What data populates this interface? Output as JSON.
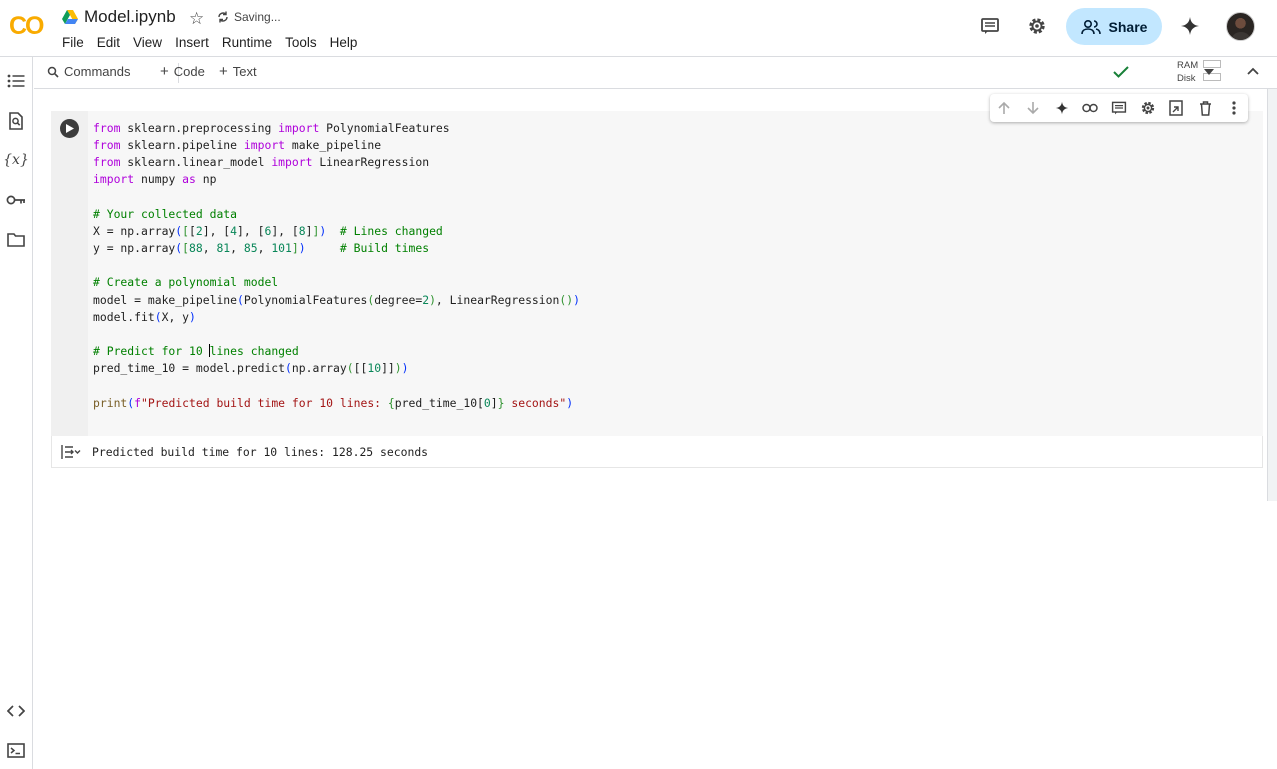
{
  "app": {
    "logo_text": "CO",
    "filename": "Model.ipynb",
    "save_status": "Saving...",
    "menu": [
      "File",
      "Edit",
      "View",
      "Insert",
      "Runtime",
      "Tools",
      "Help"
    ],
    "share_label": "Share"
  },
  "toolbar": {
    "commands_label": "Commands",
    "add_code_label": "Code",
    "add_text_label": "Text",
    "ram_label": "RAM",
    "disk_label": "Disk"
  },
  "cell": {
    "code_lines": [
      "from sklearn.preprocessing import PolynomialFeatures",
      "from sklearn.pipeline import make_pipeline",
      "from sklearn.linear_model import LinearRegression",
      "import numpy as np",
      "",
      "# Your collected data",
      "X = np.array([[2], [4], [6], [8]])  # Lines changed",
      "y = np.array([88, 81, 85, 101])     # Build times",
      "",
      "# Create a polynomial model",
      "model = make_pipeline(PolynomialFeatures(degree=2), LinearRegression())",
      "model.fit(X, y)",
      "",
      "# Predict for 10 lines changed",
      "pred_time_10 = model.predict(np.array([[10]]))",
      "",
      "print(f\"Predicted build time for 10 lines: {pred_time_10[0]} seconds\")"
    ],
    "output_text": "Predicted build time for 10 lines: 128.25 seconds"
  },
  "icons": {
    "rail": [
      "table-of-contents-icon",
      "find-replace-icon",
      "variables-icon",
      "secrets-key-icon",
      "files-folder-icon",
      "code-snippets-icon",
      "terminal-icon"
    ],
    "cell_toolbar": [
      "move-up-icon",
      "move-down-icon",
      "gemini-sparkle-icon",
      "link-icon",
      "comment-icon",
      "settings-icon",
      "mirror-cell-icon",
      "delete-icon",
      "more-vert-icon"
    ]
  },
  "colors": {
    "accent_share": "#c2e7ff",
    "keyword": "#af00db",
    "comment": "#008000",
    "string": "#a31515",
    "number": "#098658",
    "status_ok": "#188038"
  }
}
